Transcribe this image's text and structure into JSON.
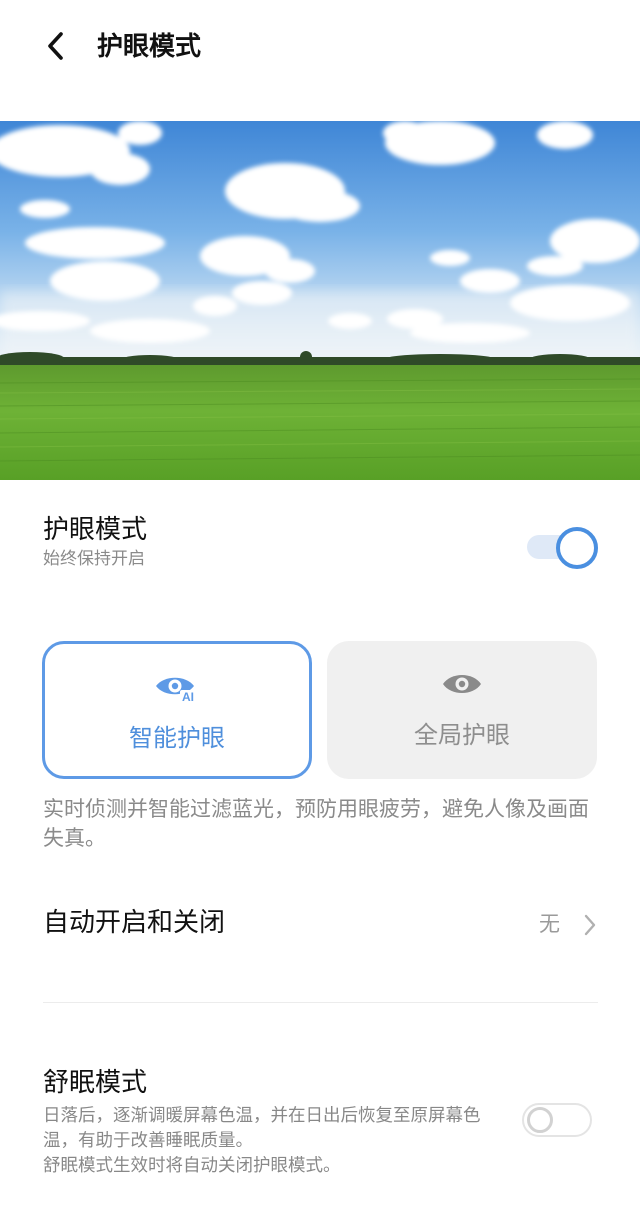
{
  "header": {
    "title": "护眼模式"
  },
  "eye_protection": {
    "title": "护眼模式",
    "subtitle": "始终保持开启",
    "enabled": true
  },
  "modes": {
    "smart": {
      "label": "智能护眼",
      "icon": "eye-ai-icon",
      "selected": true
    },
    "global": {
      "label": "全局护眼",
      "icon": "eye-icon",
      "selected": false
    },
    "description": "实时侦测并智能过滤蓝光，预防用眼疲劳，避免人像及画面失真。",
    "icon_badge": "AI"
  },
  "auto_schedule": {
    "title": "自动开启和关闭",
    "value": "无"
  },
  "sleep_mode": {
    "title": "舒眠模式",
    "description_line1": "日落后，逐渐调暖屏幕色温，并在日出后恢复至原屏幕色温，有助于改善睡眠质量。",
    "description_line2": "舒眠模式生效时将自动关闭护眼模式。",
    "enabled": false
  },
  "colors": {
    "accent": "#4a8fe0",
    "active_card_border": "#5e9ae6",
    "secondary_text": "#8a8a8a"
  }
}
